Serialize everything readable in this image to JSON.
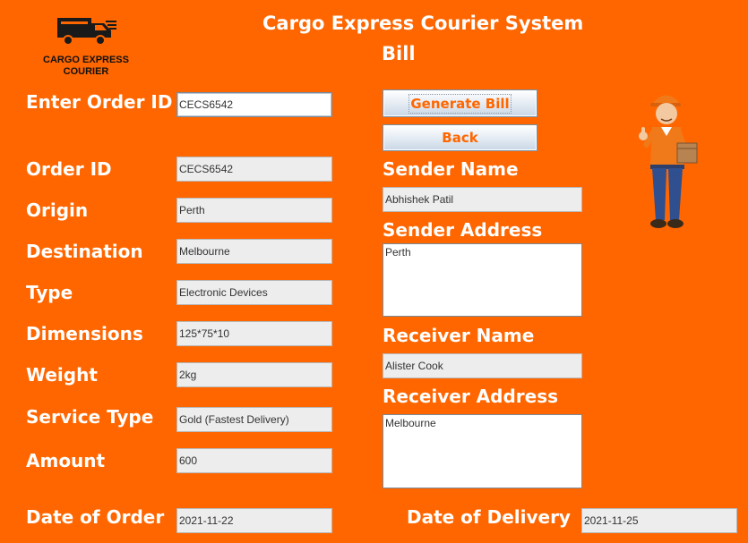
{
  "header": {
    "system_title": "Cargo Express Courier System",
    "subtitle": "Bill",
    "logo_line1": "CARGO EXPRESS",
    "logo_line2": "COURIER"
  },
  "order_lookup": {
    "label": "Enter Order ID",
    "value": "CECS6542"
  },
  "buttons": {
    "generate": "Generate Bill",
    "back": "Back"
  },
  "left_fields": [
    {
      "label": "Order ID",
      "value": "CECS6542"
    },
    {
      "label": "Origin",
      "value": "Perth"
    },
    {
      "label": "Destination",
      "value": "Melbourne"
    },
    {
      "label": "Type",
      "value": "Electronic Devices"
    },
    {
      "label": "Dimensions",
      "value": "125*75*10"
    },
    {
      "label": "Weight",
      "value": "2kg"
    },
    {
      "label": "Service Type",
      "value": "Gold (Fastest Delivery)"
    },
    {
      "label": "Amount",
      "value": "600"
    },
    {
      "label": "Date of Order",
      "value": "2021-11-22"
    }
  ],
  "sender": {
    "name_label": "Sender Name",
    "name_value": "Abhishek Patil",
    "address_label": "Sender Address",
    "address_value": "Perth"
  },
  "receiver": {
    "name_label": "Receiver Name",
    "name_value": "Alister Cook",
    "address_label": "Receiver Address",
    "address_value": "Melbourne"
  },
  "delivery": {
    "label": "Date of Delivery",
    "value": "2021-11-25"
  },
  "colors": {
    "background": "#ff6600",
    "button_text": "#ff6600"
  },
  "icons": {
    "logo": "truck-icon",
    "mascot": "courier-man-icon"
  }
}
